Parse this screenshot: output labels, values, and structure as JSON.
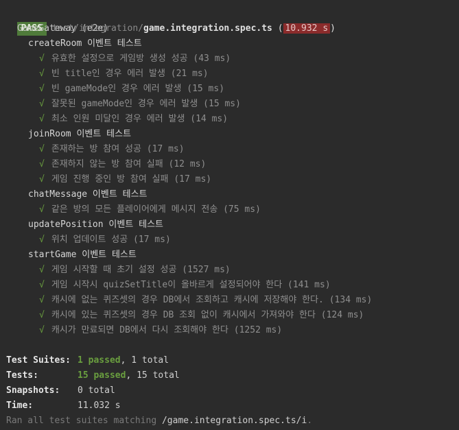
{
  "header": {
    "status": "PASS",
    "path_dir": "test/integration/",
    "file_name": "game.integration.spec.ts",
    "paren_open": "(",
    "duration": "10.932 s",
    "paren_close": ")"
  },
  "suite": {
    "title": "GameGateway (e2e)",
    "groups": [
      {
        "title": "createRoom 이벤트 테스트",
        "tests": [
          "유효한 설정으로 게임방 생성 성공 (43 ms)",
          "빈 title인 경우 에러 발생 (21 ms)",
          "빈 gameMode인 경우 에러 발생 (15 ms)",
          "잘못된 gameMode인 경우 에러 발생 (15 ms)",
          "최소 인원 미달인 경우 에러 발생 (14 ms)"
        ]
      },
      {
        "title": "joinRoom 이벤트 테스트",
        "tests": [
          "존재하는 방 참여 성공 (17 ms)",
          "존재하지 않는 방 참여 실패 (12 ms)",
          "게임 진행 중인 방 참여 실패 (17 ms)"
        ]
      },
      {
        "title": "chatMessage 이벤트 테스트",
        "tests": [
          "같은 방의 모든 플레이어에게 메시지 전송 (75 ms)"
        ]
      },
      {
        "title": "updatePosition 이벤트 테스트",
        "tests": [
          "위치 업데이트 성공 (17 ms)"
        ]
      },
      {
        "title": "startGame 이벤트 테스트",
        "tests": [
          "게임 시작할 때 초기 설정 성공 (1527 ms)",
          "게임 시작시 quizSetTitle이 올바르게 설정되어야 한다 (141 ms)",
          "캐시에 없는 퀴즈셋의 경우 DB에서 조회하고 캐시에 저장해야 한다. (134 ms)",
          "캐시에 있는 퀴즈셋의 경우 DB 조회 없이 캐시에서 가져와야 한다 (124 ms)",
          "캐시가 만료되면 DB에서 다시 조회해야 한다 (1252 ms)"
        ]
      }
    ]
  },
  "check_mark": "√",
  "summary": {
    "suites_label": "Test Suites:",
    "suites_passed": "1 passed",
    "suites_total": ", 1 total",
    "tests_label": "Tests:",
    "tests_passed": "15 passed",
    "tests_total": ", 15 total",
    "snapshots_label": "Snapshots:",
    "snapshots_value": "0 total",
    "time_label": "Time:",
    "time_value": "11.032 s",
    "ran_prefix": "Ran all test suites matching ",
    "ran_pattern": "/game.integration.spec.ts/i",
    "ran_suffix": "."
  },
  "colors": {
    "background": "#2b2b2b",
    "pass_badge": "#4f7b3a",
    "duration_badge": "#8b2b2b",
    "check_green": "#6a9f3f"
  }
}
